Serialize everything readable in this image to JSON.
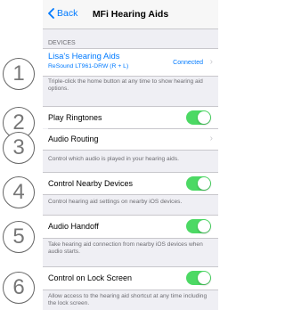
{
  "nav": {
    "back_label": "Back",
    "title": "MFi Hearing Aids"
  },
  "devices": {
    "header": "DEVICES",
    "device_name": "Lisa's Hearing Aids",
    "device_model": "ReSound LT961-DRW (R + L)",
    "status": "Connected",
    "footer": "Triple-click the home button at any time to show hearing aid options."
  },
  "play_ringtones": {
    "label": "Play Ringtones",
    "on": true
  },
  "audio_routing": {
    "label": "Audio Routing",
    "footer": "Control which audio is played in your hearing aids."
  },
  "control_nearby": {
    "label": "Control Nearby Devices",
    "on": true,
    "footer": "Control hearing aid settings on nearby iOS devices."
  },
  "audio_handoff": {
    "label": "Audio Handoff",
    "on": true,
    "footer": "Take hearing aid connection from nearby iOS devices when audio starts."
  },
  "lock_screen": {
    "label": "Control on Lock Screen",
    "on": true,
    "footer": "Allow access to the hearing aid shortcut at any time including the lock screen."
  },
  "callouts": [
    "1",
    "2",
    "3",
    "4",
    "5",
    "6"
  ],
  "colors": {
    "accent": "#007aff",
    "toggle_on": "#4cd964",
    "background": "#efeff4"
  }
}
